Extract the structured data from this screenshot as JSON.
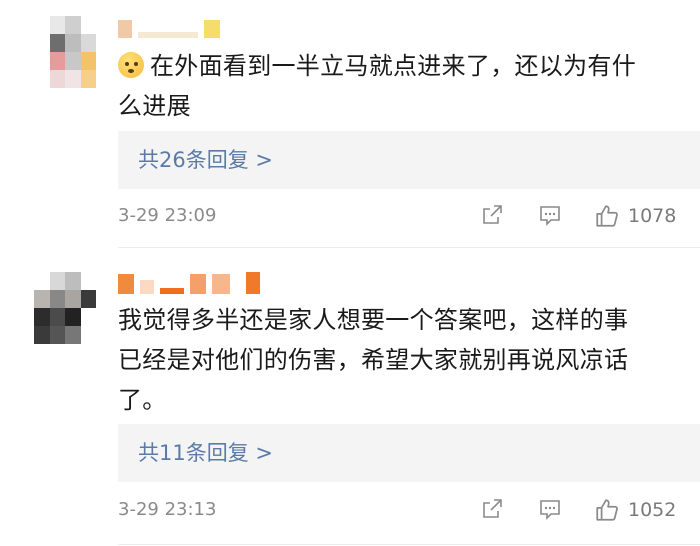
{
  "comments": [
    {
      "text_line1": "在外面看到一半立马就点进来了，还以为有什",
      "text_line2": "么进展",
      "emoji_icon": "face-without-mouth-emoji",
      "replies_label": "共26条回复 >",
      "time": "3-29 23:09",
      "likes": "1078"
    },
    {
      "text_line1": "我觉得多半还是家人想要一个答案吧，这样的事",
      "text_line2": "已经是对他们的伤害，希望大家就别再说风凉话",
      "text_line3": "了。",
      "replies_label": "共11条回复 >",
      "time": "3-29 23:13",
      "likes": "1052"
    }
  ],
  "icons": {
    "share": "share-icon",
    "comment": "comment-icon",
    "like": "thumbs-up-icon"
  },
  "colors": {
    "link": "#5b7ba6",
    "meta": "#8a8a8a",
    "reply_bg": "#f4f4f4"
  }
}
